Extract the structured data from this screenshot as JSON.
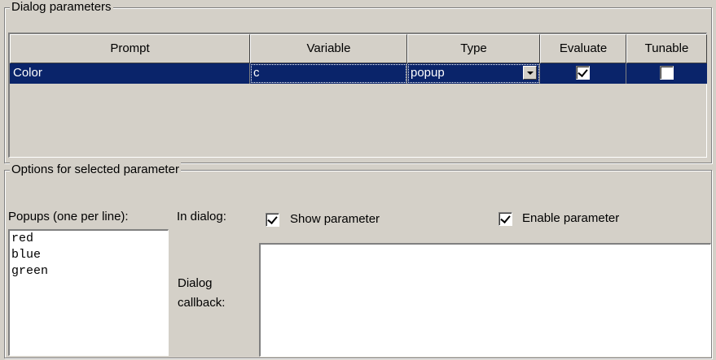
{
  "dialog_params": {
    "title": "Dialog parameters",
    "columns": [
      "Prompt",
      "Variable",
      "Type",
      "Evaluate",
      "Tunable"
    ],
    "rows": [
      {
        "prompt": "Color",
        "variable": "c",
        "type": "popup",
        "evaluate": true,
        "tunable": false
      }
    ]
  },
  "options": {
    "title": "Options for selected parameter",
    "popups_label": "Popups (one per line):",
    "popup_values": [
      "red",
      "blue",
      "green"
    ],
    "in_dialog_label": "In dialog:",
    "show_parameter_label": "Show parameter",
    "show_parameter_checked": true,
    "enable_parameter_label": "Enable parameter",
    "enable_parameter_checked": true,
    "dialog_callback_label_1": "Dialog",
    "dialog_callback_label_2": "callback:",
    "dialog_callback_value": ""
  },
  "colors": {
    "selection": "#0a246a",
    "face": "#d4d0c8"
  }
}
